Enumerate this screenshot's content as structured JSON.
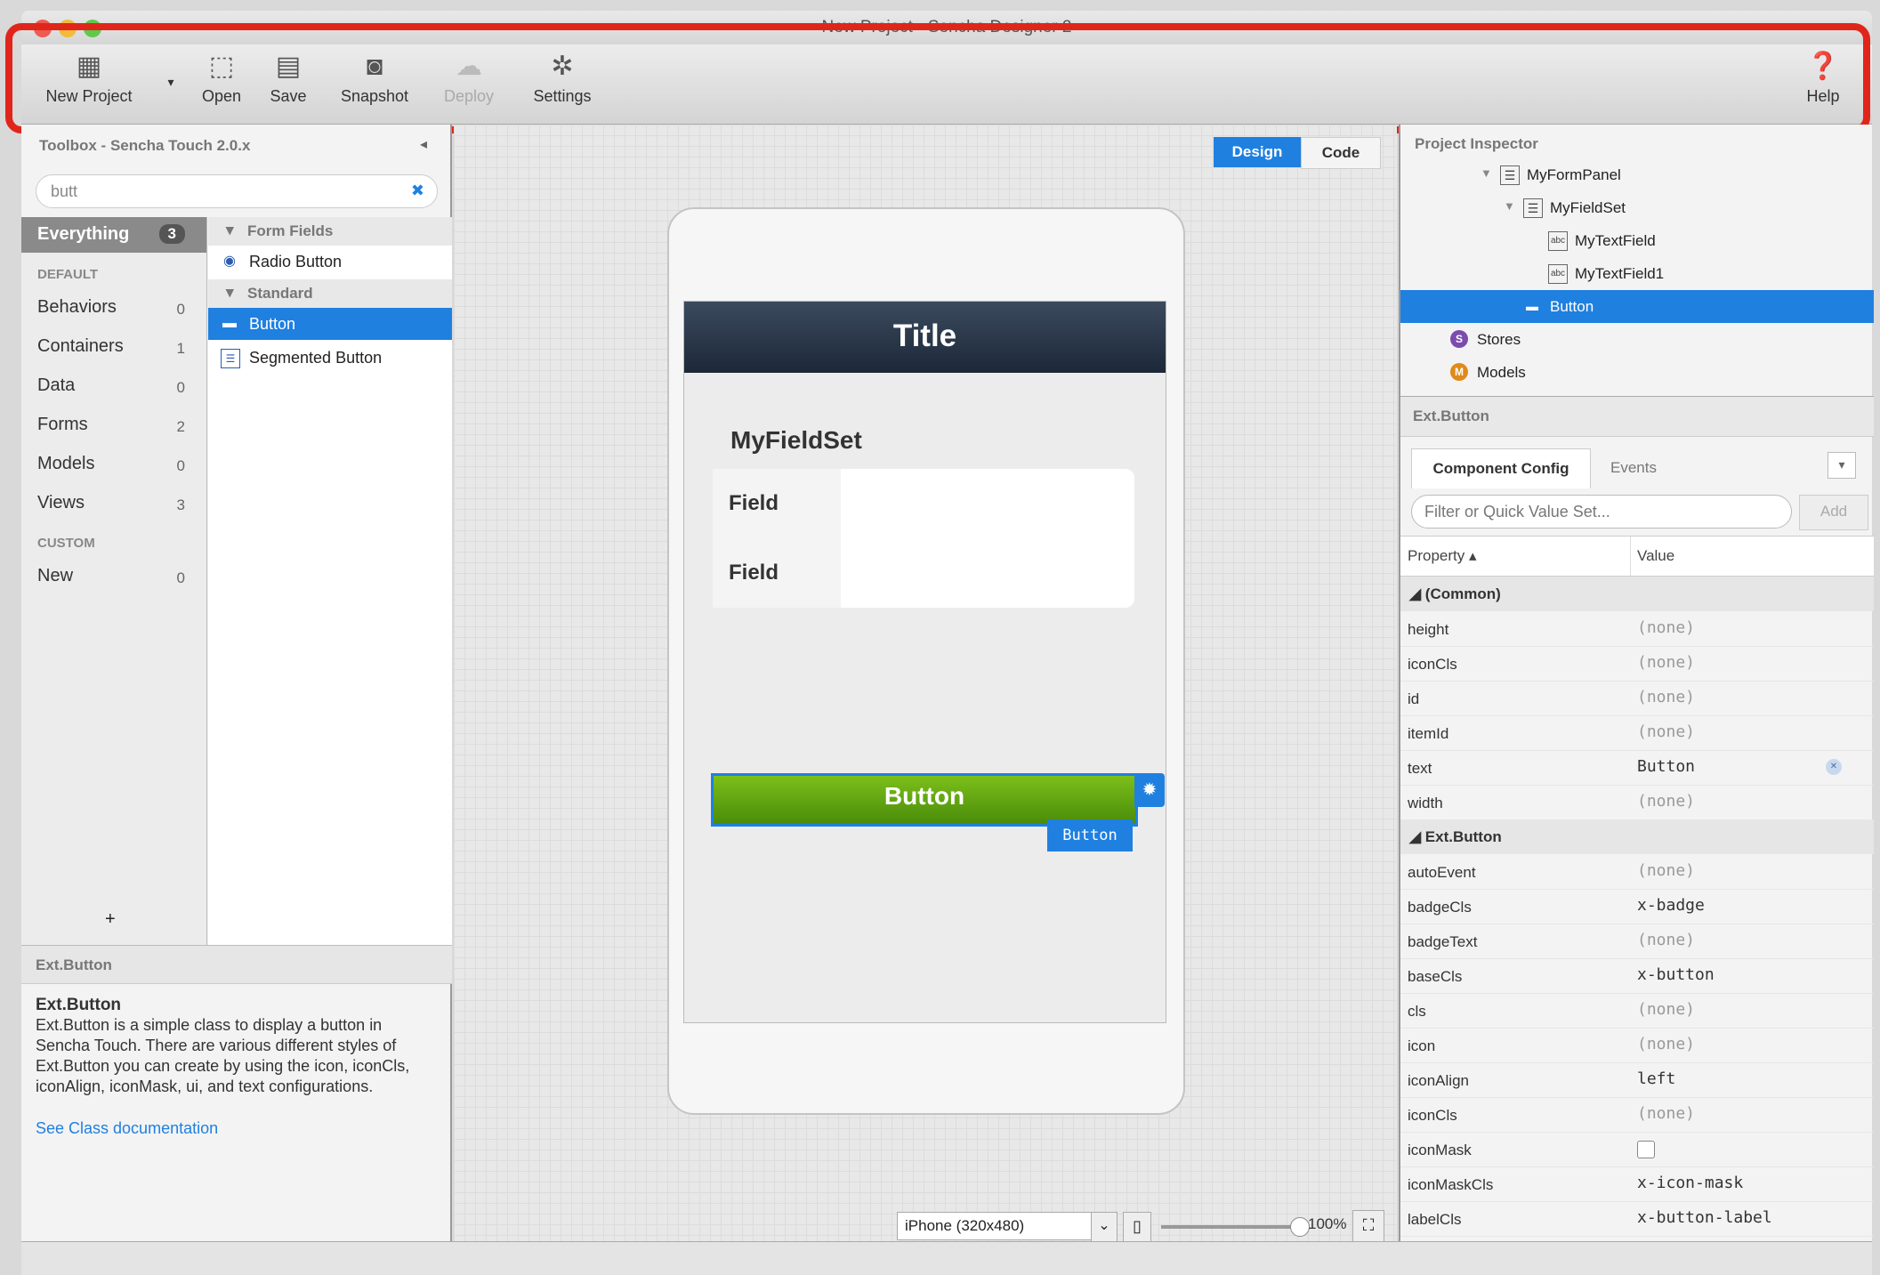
{
  "window": {
    "title": "New Project - Sencha Designer 2"
  },
  "toolbar": {
    "new_project": "New Project",
    "open": "Open",
    "save": "Save",
    "snapshot": "Snapshot",
    "deploy": "Deploy",
    "settings": "Settings",
    "help": "Help"
  },
  "toolbox": {
    "title": "Toolbox - Sencha Touch 2.0.x",
    "search_value": "butt",
    "categories": [
      {
        "label": "Everything",
        "count": "3"
      },
      {
        "label": "Behaviors",
        "count": "0"
      },
      {
        "label": "Containers",
        "count": "1"
      },
      {
        "label": "Data",
        "count": "0"
      },
      {
        "label": "Forms",
        "count": "2"
      },
      {
        "label": "Models",
        "count": "0"
      },
      {
        "label": "Views",
        "count": "3"
      },
      {
        "label": "New",
        "count": "0"
      }
    ],
    "section_default": "DEFAULT",
    "section_custom": "CUSTOM",
    "add_label": "+",
    "groups": {
      "form_fields": "Form Fields",
      "standard": "Standard"
    },
    "components": {
      "radio": "Radio Button",
      "button": "Button",
      "segmented": "Segmented Button"
    }
  },
  "description": {
    "header": "Ext.Button",
    "title": "Ext.Button",
    "body": "Ext.Button is a simple class to display a button in Sencha Touch. There are various different styles of Ext.Button you can create by using the icon, iconCls, iconAlign, iconMask, ui, and text configurations.",
    "link": "See Class documentation"
  },
  "canvas": {
    "design_tab": "Design",
    "code_tab": "Code",
    "nav_title": "Title",
    "fieldset_title": "MyFieldSet",
    "field1": "Field",
    "field2": "Field",
    "button_text": "Button",
    "button_tag": "Button",
    "device": "iPhone (320x480)",
    "zoom": "100%"
  },
  "inspector": {
    "title": "Project Inspector",
    "tree": {
      "formpanel": "MyFormPanel",
      "fieldset": "MyFieldSet",
      "textfield": "MyTextField",
      "textfield1": "MyTextField1",
      "button": "Button",
      "stores": "Stores",
      "models": "Models"
    }
  },
  "config": {
    "header": "Ext.Button",
    "tab_component": "Component Config",
    "tab_events": "Events",
    "filter_placeholder": "Filter or Quick Value Set...",
    "add": "Add",
    "col_property": "Property ▴",
    "col_value": "Value",
    "group_common": "◢ (Common)",
    "group_button": "◢ Ext.Button",
    "rows": {
      "height": {
        "name": "height",
        "value": "(none)"
      },
      "iconCls": {
        "name": "iconCls",
        "value": "(none)"
      },
      "id": {
        "name": "id",
        "value": "(none)"
      },
      "itemId": {
        "name": "itemId",
        "value": "(none)"
      },
      "text": {
        "name": "text",
        "value": "Button"
      },
      "width": {
        "name": "width",
        "value": "(none)"
      },
      "autoEvent": {
        "name": "autoEvent",
        "value": "(none)"
      },
      "badgeCls": {
        "name": "badgeCls",
        "value": "x-badge"
      },
      "badgeText": {
        "name": "badgeText",
        "value": "(none)"
      },
      "baseCls": {
        "name": "baseCls",
        "value": "x-button"
      },
      "cls": {
        "name": "cls",
        "value": "(none)"
      },
      "icon": {
        "name": "icon",
        "value": "(none)"
      },
      "iconAlign": {
        "name": "iconAlign",
        "value": "left"
      },
      "iconCls2": {
        "name": "iconCls",
        "value": "(none)"
      },
      "iconMask": {
        "name": "iconMask",
        "value": ""
      },
      "iconMaskCls": {
        "name": "iconMaskCls",
        "value": "x-icon-mask"
      },
      "labelCls": {
        "name": "labelCls",
        "value": "x-button-label"
      }
    }
  },
  "colors": {
    "accent": "#1f80e0",
    "annotation": "#e0261b",
    "button_green": "#5aa30f",
    "nav_dark": "#1c2838"
  }
}
